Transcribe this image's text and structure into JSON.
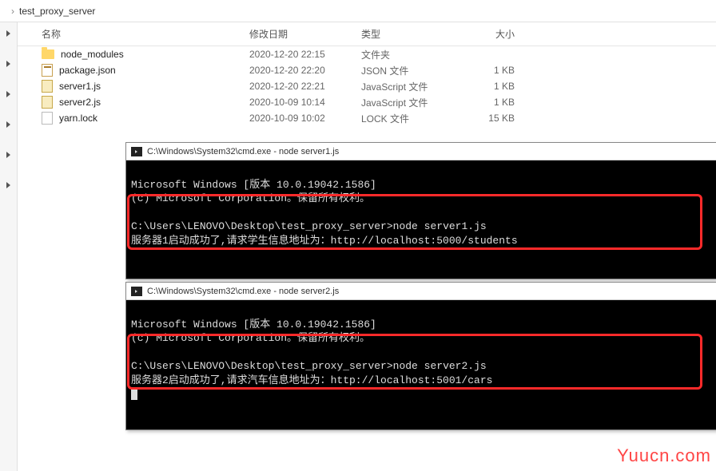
{
  "breadcrumb": {
    "chev": "›",
    "folder": "test_proxy_server"
  },
  "headers": {
    "name": "名称",
    "date": "修改日期",
    "type": "类型",
    "size": "大小"
  },
  "files": [
    {
      "icon": "folder",
      "name": "node_modules",
      "date": "2020-12-20 22:15",
      "type": "文件夹",
      "size": ""
    },
    {
      "icon": "json",
      "name": "package.json",
      "date": "2020-12-20 22:20",
      "type": "JSON 文件",
      "size": "1 KB"
    },
    {
      "icon": "js",
      "name": "server1.js",
      "date": "2020-12-20 22:21",
      "type": "JavaScript 文件",
      "size": "1 KB"
    },
    {
      "icon": "js",
      "name": "server2.js",
      "date": "2020-10-09 10:14",
      "type": "JavaScript 文件",
      "size": "1 KB"
    },
    {
      "icon": "lock",
      "name": "yarn.lock",
      "date": "2020-10-09 10:02",
      "type": "LOCK 文件",
      "size": "15 KB"
    }
  ],
  "term1": {
    "title": "C:\\Windows\\System32\\cmd.exe - node  server1.js",
    "line1": "Microsoft Windows [版本 10.0.19042.1586]",
    "line2": "(c) Microsoft Corporation。保留所有权利。",
    "line3": "C:\\Users\\LENOVO\\Desktop\\test_proxy_server>node server1.js",
    "line4": "服务器1启动成功了,请求学生信息地址为：http://localhost:5000/students"
  },
  "term2": {
    "title": "C:\\Windows\\System32\\cmd.exe - node  server2.js",
    "line1": "Microsoft Windows [版本 10.0.19042.1586]",
    "line2": "(c) Microsoft Corporation。保留所有权利。",
    "line3": "C:\\Users\\LENOVO\\Desktop\\test_proxy_server>node server2.js",
    "line4": "服务器2启动成功了,请求汽车信息地址为：http://localhost:5001/cars"
  },
  "watermark": "Yuucn.com"
}
